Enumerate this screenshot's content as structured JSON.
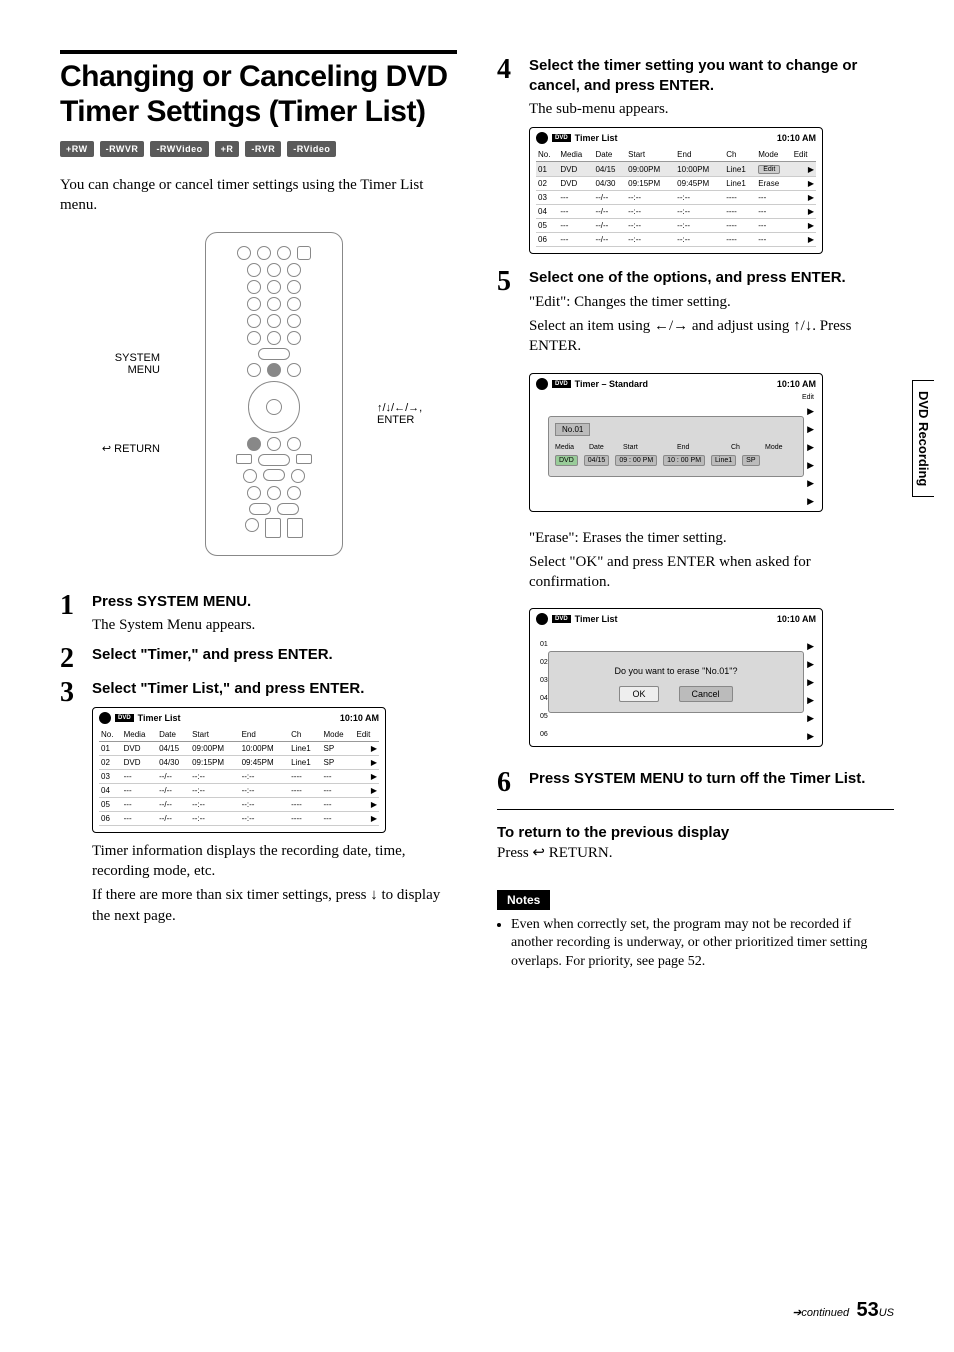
{
  "side_tab": "DVD Recording",
  "title": "Changing or Canceling DVD Timer Settings (Timer List)",
  "formats": [
    "+RW",
    "-RWVR",
    "-RWVideo",
    "+R",
    "-RVR",
    "-RVideo"
  ],
  "intro": "You can change or cancel timer settings using the Timer List menu.",
  "callouts": {
    "system_menu": "SYSTEM MENU",
    "return": "RETURN",
    "enter": "↑/↓/←/→, ENTER"
  },
  "steps": {
    "s1": {
      "head": "Press SYSTEM MENU.",
      "body": "The System Menu appears."
    },
    "s2": {
      "head": "Select \"Timer,\" and press ENTER."
    },
    "s3": {
      "head": "Select \"Timer List,\" and press ENTER."
    },
    "s3_after1": "Timer information displays the recording date, time, recording mode, etc.",
    "s3_after2": "If there are more than six timer settings, press ↓ to display the next page.",
    "s4": {
      "head": "Select the timer setting you want to change or cancel, and press ENTER.",
      "body": "The sub-menu appears."
    },
    "s5": {
      "head": "Select one of the options, and press ENTER.",
      "body1": "\"Edit\": Changes the timer setting.",
      "body2": "Select an item using ←/→ and adjust using ↑/↓. Press ENTER.",
      "body3": "\"Erase\": Erases the timer setting.",
      "body4": "Select \"OK\" and press ENTER when asked for confirmation."
    },
    "s6": {
      "head": "Press SYSTEM MENU to turn off the Timer List."
    }
  },
  "panel_common": {
    "title": "Timer List",
    "clock": "10:10 AM",
    "edit_title": "Timer – Standard",
    "columns": [
      "No.",
      "Media",
      "Date",
      "Start",
      "End",
      "Ch",
      "Mode",
      "Edit"
    ]
  },
  "panel_step3_rows": [
    {
      "no": "01",
      "media": "DVD",
      "date": "04/15",
      "start": "09:00PM",
      "end": "10:00PM",
      "ch": "Line1",
      "mode": "SP"
    },
    {
      "no": "02",
      "media": "DVD",
      "date": "04/30",
      "start": "09:15PM",
      "end": "09:45PM",
      "ch": "Line1",
      "mode": "SP"
    },
    {
      "no": "03",
      "media": "---",
      "date": "--/--",
      "start": "--:--",
      "end": "--:--",
      "ch": "----",
      "mode": "---"
    },
    {
      "no": "04",
      "media": "---",
      "date": "--/--",
      "start": "--:--",
      "end": "--:--",
      "ch": "----",
      "mode": "---"
    },
    {
      "no": "05",
      "media": "---",
      "date": "--/--",
      "start": "--:--",
      "end": "--:--",
      "ch": "----",
      "mode": "---"
    },
    {
      "no": "06",
      "media": "---",
      "date": "--/--",
      "start": "--:--",
      "end": "--:--",
      "ch": "----",
      "mode": "---"
    }
  ],
  "panel_step4": {
    "rows": [
      {
        "no": "01",
        "media": "DVD",
        "date": "04/15",
        "start": "09:00PM",
        "end": "10:00PM",
        "ch": "Line1",
        "mode": "Edit",
        "hl": true
      },
      {
        "no": "02",
        "media": "DVD",
        "date": "04/30",
        "start": "09:15PM",
        "end": "09:45PM",
        "ch": "Line1",
        "mode": "Erase"
      },
      {
        "no": "03",
        "media": "---",
        "date": "--/--",
        "start": "--:--",
        "end": "--:--",
        "ch": "----",
        "mode": "---"
      },
      {
        "no": "04",
        "media": "---",
        "date": "--/--",
        "start": "--:--",
        "end": "--:--",
        "ch": "----",
        "mode": "---"
      },
      {
        "no": "05",
        "media": "---",
        "date": "--/--",
        "start": "--:--",
        "end": "--:--",
        "ch": "----",
        "mode": "---"
      },
      {
        "no": "06",
        "media": "---",
        "date": "--/--",
        "start": "--:--",
        "end": "--:--",
        "ch": "----",
        "mode": "---"
      }
    ]
  },
  "edit_dialog": {
    "rec_no": "No.01",
    "labels": [
      "Media",
      "Date",
      "Start",
      "End",
      "Ch",
      "Mode"
    ],
    "values": [
      "DVD",
      "04/15",
      "09 : 00 PM",
      "10 : 00 PM",
      "Line1",
      "SP"
    ]
  },
  "erase_dialog": {
    "msg": "Do you want to erase \"No.01\"?",
    "ok": "OK",
    "cancel": "Cancel"
  },
  "return_section": {
    "head": "To return to the previous display",
    "body": "Press ↩ RETURN."
  },
  "notes_label": "Notes",
  "notes": [
    "Even when correctly set, the program may not be recorded if another recording is underway, or other prioritized timer setting overlaps. For priority, see page 52."
  ],
  "footer": {
    "continued": "➔continued",
    "page": "53",
    "suffix": "US"
  }
}
